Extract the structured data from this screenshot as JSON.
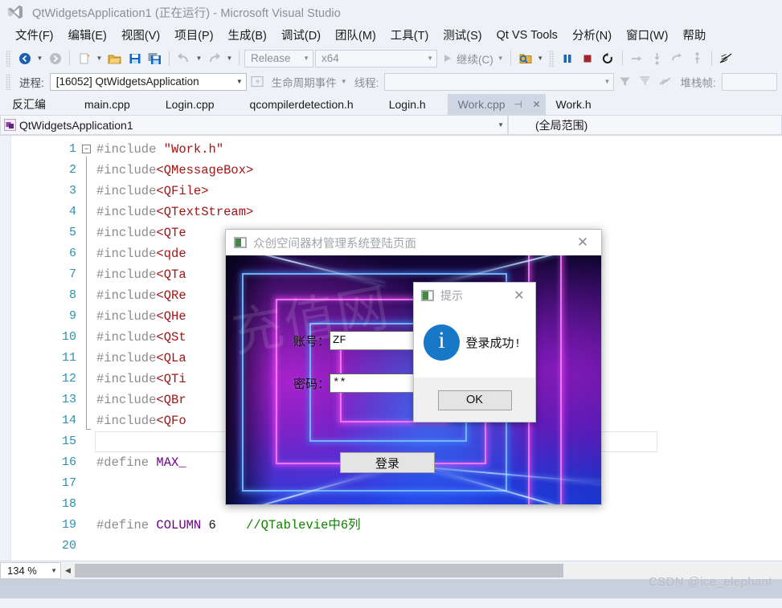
{
  "window": {
    "title": "QtWidgetsApplication1 (正在运行) - Microsoft Visual Studio",
    "logo_icon": "visual-studio-logo-icon"
  },
  "menubar": {
    "items": [
      {
        "label": "文件(F)"
      },
      {
        "label": "编辑(E)"
      },
      {
        "label": "视图(V)"
      },
      {
        "label": "项目(P)"
      },
      {
        "label": "生成(B)"
      },
      {
        "label": "调试(D)"
      },
      {
        "label": "团队(M)"
      },
      {
        "label": "工具(T)"
      },
      {
        "label": "测试(S)"
      },
      {
        "label": "Qt VS Tools"
      },
      {
        "label": "分析(N)"
      },
      {
        "label": "窗口(W)"
      },
      {
        "label": "帮助"
      }
    ]
  },
  "toolbar_main": {
    "back_icon": "navigate-back-icon",
    "forward_icon": "navigate-forward-icon",
    "new_item_icon": "new-item-icon",
    "open_icon": "open-folder-icon",
    "save_icon": "save-icon",
    "save_all_icon": "save-all-icon",
    "undo_icon": "undo-icon",
    "redo_icon": "redo-icon",
    "config_value": "Release",
    "platform_value": "x64",
    "continue_label": "继续(C)",
    "continue_icon": "play-icon",
    "find_icon": "find-in-files-icon",
    "pause_icon": "pause-icon",
    "stop_icon": "stop-icon",
    "restart_icon": "restart-icon",
    "step_over_icon": "step-over-icon",
    "step_into_icon": "step-into-icon",
    "step_out_icon": "step-out-icon",
    "show_next_statement_icon": "show-next-statement-icon",
    "hex_icon": "hex-toggle-icon"
  },
  "toolbar_debug": {
    "process_label": "进程:",
    "process_value": "[16052] QtWidgetsApplication",
    "lifecycle_icon": "lifecycle-events-icon",
    "lifecycle_label": "生命周期事件",
    "thread_label": "线程:",
    "thread_value": "",
    "filter_icon": "filter-icon",
    "filter_clear_icon": "filter-clear-icon",
    "flag_icon": "flag-icon",
    "stackframe_label": "堆栈帧:",
    "stackframe_value": ""
  },
  "tabs": {
    "items": [
      {
        "label": "反汇编",
        "active": false,
        "closable": false
      },
      {
        "label": "main.cpp",
        "active": false,
        "closable": false
      },
      {
        "label": "Login.cpp",
        "active": false,
        "closable": false
      },
      {
        "label": "qcompilerdetection.h",
        "active": false,
        "closable": false
      },
      {
        "label": "Login.h",
        "active": false,
        "closable": false
      },
      {
        "label": "Work.cpp",
        "active": true,
        "closable": true
      },
      {
        "label": "Work.h",
        "active": false,
        "closable": false
      }
    ],
    "pin_icon": "pin-icon",
    "close_icon": "close-icon"
  },
  "navbar": {
    "project_icon": "project-icon",
    "project_value": "QtWidgetsApplication1",
    "scope_value": "(全局范围)",
    "chevron_icon": "chevron-down-icon"
  },
  "editor": {
    "lines": [
      {
        "no": "1",
        "segments": [
          {
            "t": "#include ",
            "c": "kw"
          },
          {
            "t": "\"Work.h\"",
            "c": "str"
          }
        ],
        "fold": true
      },
      {
        "no": "2",
        "segments": [
          {
            "t": "#include",
            "c": "kw"
          },
          {
            "t": "<QMessageBox>",
            "c": "inc"
          }
        ]
      },
      {
        "no": "3",
        "segments": [
          {
            "t": "#include",
            "c": "kw"
          },
          {
            "t": "<QFile>",
            "c": "inc"
          }
        ]
      },
      {
        "no": "4",
        "segments": [
          {
            "t": "#include",
            "c": "kw"
          },
          {
            "t": "<QTextStream>",
            "c": "inc"
          }
        ]
      },
      {
        "no": "5",
        "segments": [
          {
            "t": "#include",
            "c": "kw"
          },
          {
            "t": "<QTe",
            "c": "inc"
          }
        ]
      },
      {
        "no": "6",
        "segments": [
          {
            "t": "#include",
            "c": "kw"
          },
          {
            "t": "<qde",
            "c": "inc"
          }
        ]
      },
      {
        "no": "7",
        "segments": [
          {
            "t": "#include",
            "c": "kw"
          },
          {
            "t": "<QTa",
            "c": "inc"
          }
        ]
      },
      {
        "no": "8",
        "segments": [
          {
            "t": "#include",
            "c": "kw"
          },
          {
            "t": "<QRe",
            "c": "inc"
          }
        ]
      },
      {
        "no": "9",
        "segments": [
          {
            "t": "#include",
            "c": "kw"
          },
          {
            "t": "<QHe",
            "c": "inc"
          }
        ]
      },
      {
        "no": "10",
        "segments": [
          {
            "t": "#include",
            "c": "kw"
          },
          {
            "t": "<QSt",
            "c": "inc"
          }
        ]
      },
      {
        "no": "11",
        "segments": [
          {
            "t": "#include",
            "c": "kw"
          },
          {
            "t": "<QLa",
            "c": "inc"
          }
        ]
      },
      {
        "no": "12",
        "segments": [
          {
            "t": "#include",
            "c": "kw"
          },
          {
            "t": "<QTi",
            "c": "inc"
          }
        ]
      },
      {
        "no": "13",
        "segments": [
          {
            "t": "#include",
            "c": "kw"
          },
          {
            "t": "<QBr",
            "c": "inc"
          }
        ]
      },
      {
        "no": "14",
        "segments": [
          {
            "t": "#include",
            "c": "kw"
          },
          {
            "t": "<QFo",
            "c": "inc"
          }
        ]
      },
      {
        "no": "15",
        "segments": [],
        "current": true
      },
      {
        "no": "16",
        "segments": [
          {
            "t": "#define ",
            "c": "kw"
          },
          {
            "t": "MAX_",
            "c": "macro"
          }
        ]
      },
      {
        "no": "17",
        "segments": []
      },
      {
        "no": "18",
        "segments": []
      },
      {
        "no": "19",
        "segments": [
          {
            "t": "#define ",
            "c": "kw"
          },
          {
            "t": "COLUMN",
            "c": "macro"
          },
          {
            "t": " 6",
            "c": "num"
          },
          {
            "t": "    ",
            "c": "kw"
          },
          {
            "t": "//QTablevie中6列",
            "c": "cmt"
          }
        ]
      },
      {
        "no": "20",
        "segments": []
      }
    ]
  },
  "statusbar": {
    "zoom_value": "134 %",
    "chevron_icon": "chevron-down-icon",
    "scroll_left_icon": "scroll-left-arrow-icon"
  },
  "watermark": {
    "text": "CSDN @ice_elephant"
  },
  "qt_dialog": {
    "title": "众创空间器材管理系统登陆页面",
    "app_icon": "qt-app-icon",
    "close_icon": "close-icon",
    "background_watermark": "充值网",
    "account_label": "账号：",
    "account_value": "ZF",
    "password_label": "密码：",
    "password_value": "**",
    "login_button": "登录"
  },
  "msgbox": {
    "title": "提示",
    "app_icon": "qt-app-icon",
    "close_icon": "close-icon",
    "info_icon": "information-icon",
    "info_glyph": "i",
    "message": "登录成功!",
    "ok_button": "OK"
  },
  "colors": {
    "vs_chrome": "#eef1f6",
    "accent_blue": "#1878c8",
    "line_number": "#2b91af",
    "string_red": "#a31515",
    "macro_purple": "#6f008a",
    "comment_green": "#108000"
  }
}
